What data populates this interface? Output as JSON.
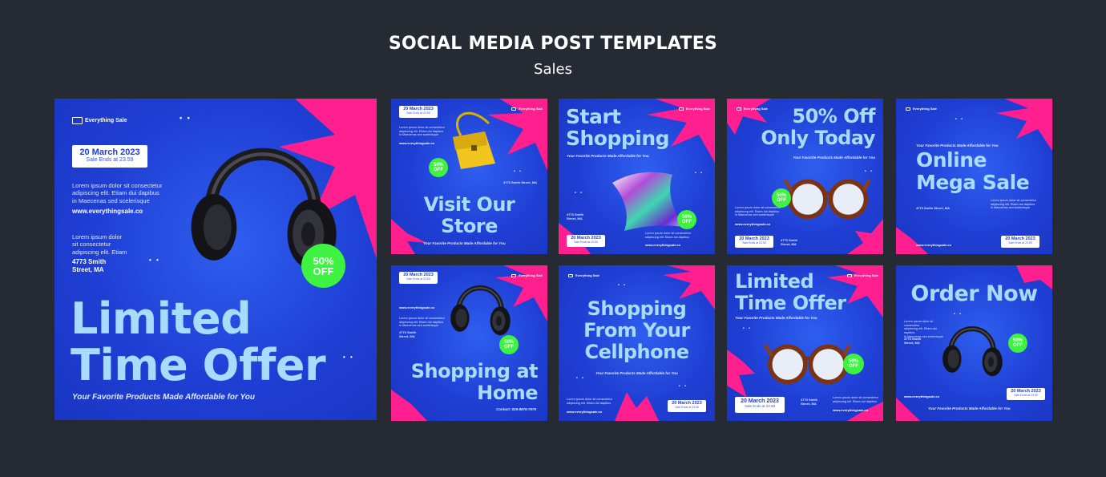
{
  "page": {
    "title": "SOCIAL MEDIA POST TEMPLATES",
    "subtitle": "Sales"
  },
  "colors": {
    "background": "#262a33",
    "card_blue": "#1f3fd4",
    "burst_pink": "#ff1f8e",
    "headline_blue": "#a8dcff",
    "badge_green": "#3df240"
  },
  "common": {
    "brand": "Everything Sale",
    "date": "20 March 2023",
    "sale_ends": "Sale Ends at 23.59",
    "lorem1": "Lorem ipsum dolor sit consectetur adipiscing elit. Etiam dui dapibus in Maecenas sed scelerisque",
    "lorem1_l1": "Lorem ipsum dolor sit consectetur",
    "lorem1_l2": "adipiscing elit. Etiam dui dapibus",
    "lorem1_l3": "in Maecenas sed scelerisque",
    "lorem2_l1": "Lorem ipsum dolor",
    "lorem2_l2": "sit consectetur",
    "lorem2_l3": "adipiscing elit. Etiam",
    "website": "www.everythingsale.co",
    "address_l1": "4773 Smith",
    "address_l2": "Street, MA",
    "address_one": "4773 Smith Street, MA",
    "tagline": "Your Favorite Products Made Affordable for You",
    "discount_l1": "50%",
    "discount_l2": "OFF",
    "contact": "Contact: 929-8876-7676"
  },
  "posts": {
    "main": {
      "headline_l1": "Limited",
      "headline_l2": "Time Offer",
      "product_icon": "headphones-icon"
    },
    "store": {
      "headline_l1": "Visit Our",
      "headline_l2": "Store",
      "product_icon": "handbag-icon"
    },
    "start": {
      "headline_l1": "Start",
      "headline_l2": "Shopping",
      "product_icon": "scarf-icon"
    },
    "fifty": {
      "headline_l1": "50% Off",
      "headline_l2": "Only Today",
      "product_icon": "glasses-icon"
    },
    "mega": {
      "headline_l1": "Online",
      "headline_l2": "Mega Sale"
    },
    "home": {
      "headline_l1": "Shopping at",
      "headline_l2": "Home",
      "product_icon": "headphones-icon"
    },
    "cell": {
      "headline_l1": "Shopping",
      "headline_l2": "From Your",
      "headline_l3": "Cellphone"
    },
    "limited2": {
      "headline_l1": "Limited",
      "headline_l2": "Time Offer",
      "product_icon": "glasses-icon"
    },
    "order": {
      "headline": "Order Now",
      "product_icon": "headphones-icon"
    }
  }
}
